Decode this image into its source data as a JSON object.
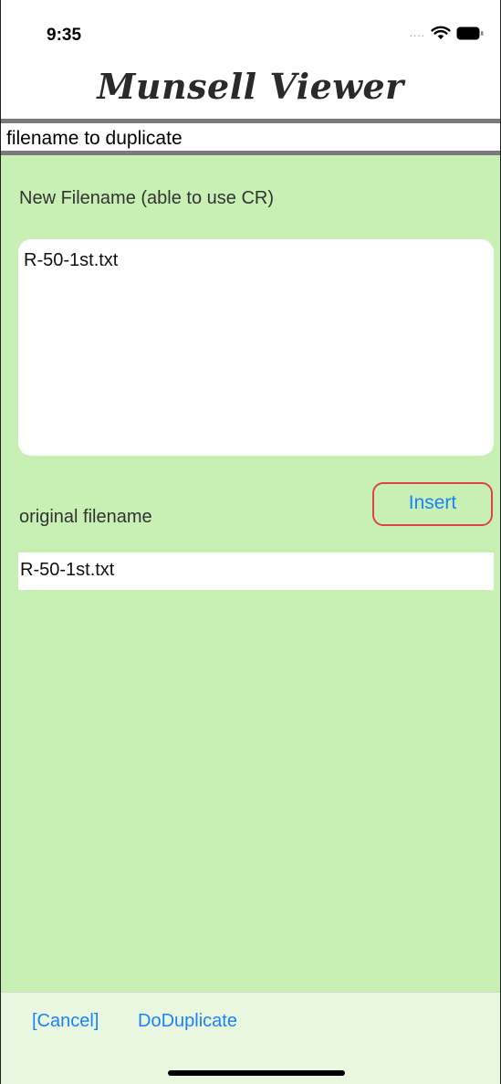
{
  "status_bar": {
    "time": "9:35",
    "signal": "....",
    "icons": [
      "wifi-icon",
      "battery-icon"
    ]
  },
  "app": {
    "title": "Munsell Viewer"
  },
  "header": {
    "title": "filename to duplicate"
  },
  "form": {
    "new_filename_label": "New Filename (able to use CR)",
    "new_filename_value": "R-50-1st.txt",
    "original_label": "original filename",
    "insert_label": "Insert",
    "original_value": "R-50-1st.txt"
  },
  "toolbar": {
    "cancel_label": "[Cancel]",
    "duplicate_label": "DoDuplicate"
  },
  "colors": {
    "content_bg": "#c8f0b4",
    "toolbar_bg": "#e9f7e1",
    "link_blue": "#1a82f7",
    "insert_border": "#e0424a",
    "divider_gray": "#7a7a7a"
  }
}
